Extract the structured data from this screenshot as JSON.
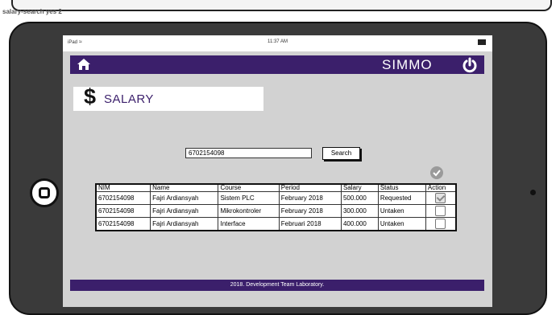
{
  "caption": "salary-search yes 2",
  "status_bar": {
    "device": "iPad",
    "time": "11:37 AM"
  },
  "navbar": {
    "brand": "SIMMO"
  },
  "page": {
    "title": "SALARY",
    "symbol": "$"
  },
  "search": {
    "value": "6702154098",
    "button_label": "Search"
  },
  "table": {
    "headers": [
      "NIM",
      "Name",
      "Course",
      "Period",
      "Salary",
      "Status",
      "Action"
    ],
    "rows": [
      {
        "nim": "6702154098",
        "name": "Fajri Ardiansyah",
        "course": "Sistem PLC",
        "period": "February 2018",
        "salary": "500.000",
        "status": "Requested",
        "checked": true
      },
      {
        "nim": "6702154098",
        "name": "Fajri Ardiansyah",
        "course": "Mikrokontroler",
        "period": "February 2018",
        "salary": "300.000",
        "status": "Untaken",
        "checked": false
      },
      {
        "nim": "6702154098",
        "name": "Fajri Ardiansyah",
        "course": "Interface",
        "period": "Februari 2018",
        "salary": "400.000",
        "status": "Untaken",
        "checked": false
      }
    ]
  },
  "footer": {
    "text": "2018. Development Team Laboratory."
  },
  "colors": {
    "brand": "#3b1f6b",
    "screen_bg": "#d2d2d2"
  }
}
